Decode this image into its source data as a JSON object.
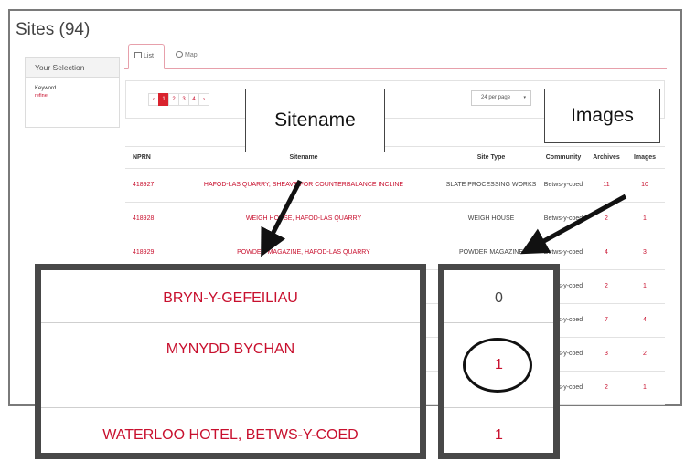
{
  "page": {
    "title": "Sites (94)"
  },
  "left_panel": {
    "header": "Your Selection",
    "keyword_label": "Keyword",
    "refine_link": "refine"
  },
  "tabs": [
    {
      "label": "List"
    },
    {
      "label": "Map"
    }
  ],
  "pager": {
    "prev": "‹",
    "pages": [
      "1",
      "2",
      "3",
      "4"
    ],
    "next": "›"
  },
  "per_page": {
    "value": "24 per page",
    "caret": "▾"
  },
  "table": {
    "headers": [
      "NPRN",
      "Sitename",
      "Site Type",
      "Community",
      "Archives",
      "Images"
    ],
    "rows": [
      {
        "nprn": "418927",
        "sitename": "HAFOD-LAS QUARRY, SHEAVE FOR COUNTERBALANCE INCLINE",
        "site_type": "SLATE PROCESSING WORKS",
        "community": "Betws-y-coed",
        "archives": "11",
        "images": "10"
      },
      {
        "nprn": "418928",
        "sitename": "WEIGH HOUSE, HAFOD-LAS QUARRY",
        "site_type": "WEIGH HOUSE",
        "community": "Betws-y-coed",
        "archives": "2",
        "images": "1"
      },
      {
        "nprn": "418929",
        "sitename": "POWDER MAGAZINE, HAFOD-LAS QUARRY",
        "site_type": "POWDER MAGAZINE",
        "community": "Betws-y-coed",
        "archives": "4",
        "images": "3"
      },
      {
        "nprn": "",
        "sitename": "",
        "site_type": "",
        "community": "Betws-y-coed",
        "archives": "2",
        "images": "1"
      },
      {
        "nprn": "",
        "sitename": "",
        "site_type": "",
        "community": "Betws-y-coed",
        "archives": "7",
        "images": "4"
      },
      {
        "nprn": "",
        "sitename": "",
        "site_type": "",
        "community": "Betws-y-coed",
        "archives": "3",
        "images": "2"
      },
      {
        "nprn": "",
        "sitename": "",
        "site_type": "",
        "community": "Betws-y-coed",
        "archives": "2",
        "images": "1"
      }
    ]
  },
  "callouts": {
    "sitename": "Sitename",
    "images": "Images"
  },
  "zoom": {
    "sitenames": [
      "BRYN-Y-GEFEILIAU",
      "MYNYDD BYCHAN",
      "WATERLOO HOTEL, BETWS-Y-COED"
    ],
    "images": [
      "0",
      "1",
      "1"
    ]
  },
  "colors": {
    "accent": "#c8102e",
    "frame": "#484848"
  }
}
